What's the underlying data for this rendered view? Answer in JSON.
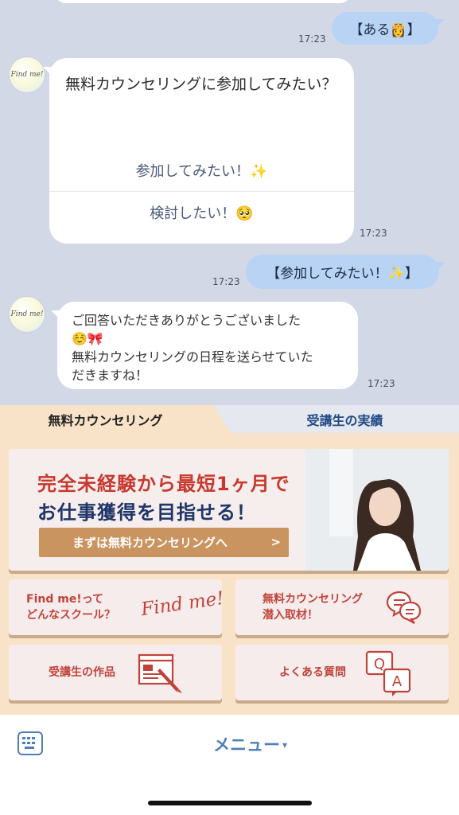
{
  "chat": {
    "messages": [
      {
        "sender": "user",
        "time": "17:23",
        "text": "【ある👸】"
      },
      {
        "sender": "bot",
        "avatar_text": "Find me!",
        "text": "無料カウンセリングに参加してみたい？",
        "options": [
          "参加してみたい！✨",
          "検討したい！🥺"
        ],
        "time": "17:23"
      },
      {
        "sender": "user",
        "time": "17:23",
        "text": "【参加してみたい！✨】"
      },
      {
        "sender": "bot",
        "avatar_text": "Find me!",
        "lines": [
          "ご回答いただきありがとうございました",
          "☺️🎀",
          "無料カウンセリングの日程を送らせていた",
          "だきますね！"
        ],
        "time": "17:23"
      }
    ]
  },
  "rich_menu": {
    "tabs": [
      {
        "label": "無料カウンセリング",
        "active": true
      },
      {
        "label": "受講生の実績",
        "active": false
      }
    ],
    "banner": {
      "line1": "完全未経験から最短1ヶ月で",
      "line2": "お仕事獲得を目指せる！",
      "cta": "まずは無料カウンセリングへ",
      "cta_chevron": ">"
    },
    "buttons": {
      "about": {
        "lines": [
          "Find me!って",
          "どんなスクール？"
        ],
        "logo": "Find me!",
        "icon": "find-me-logo"
      },
      "interview": {
        "lines": [
          "無料カウンセリング",
          "潜入取材！"
        ],
        "icon": "chat-bubbles-icon"
      },
      "works": {
        "label": "受講生の作品",
        "icon": "design-pen-icon"
      },
      "faq": {
        "label": "よくある質問",
        "icon": "qa-icon",
        "q": "Q",
        "a": "A"
      }
    }
  },
  "bottom_bar": {
    "menu_label": "メニュー",
    "menu_caret": "▾",
    "keyboard_icon": "keyboard-icon"
  },
  "colors": {
    "chat_bg": "#d3d8e6",
    "sent_bubble": "#b8d3f3",
    "menu_bg": "#f8e3c8",
    "accent_red": "#c0433a",
    "accent_navy": "#1f3568",
    "accent_blue": "#4f7fb8",
    "cta_brown": "#c99460"
  }
}
